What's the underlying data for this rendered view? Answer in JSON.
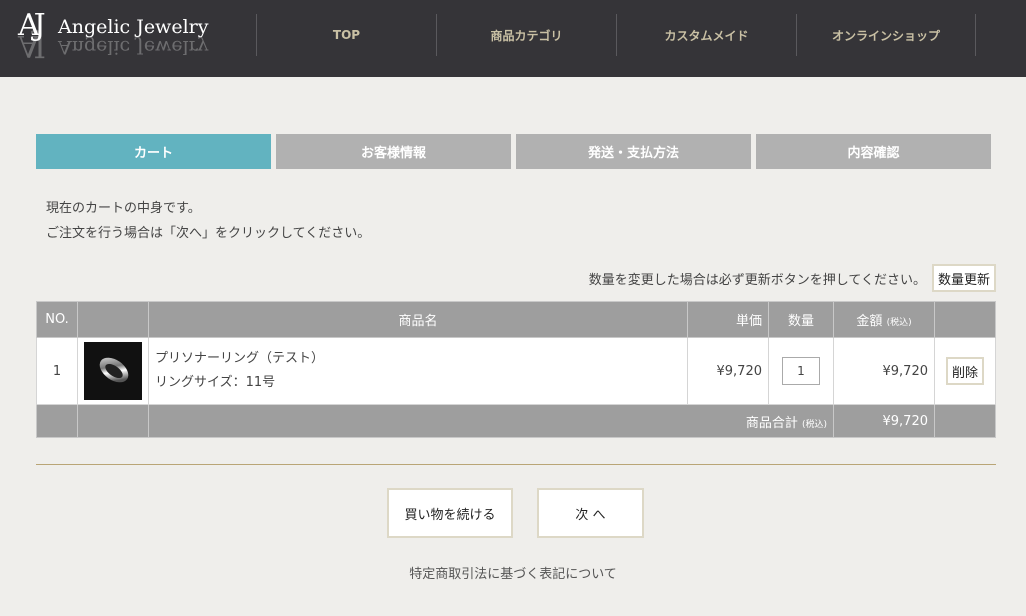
{
  "header": {
    "logo_mark": "AJ",
    "logo_text": "Angelic Jewelry",
    "nav": [
      "TOP",
      "商品カテゴリ",
      "カスタムメイド",
      "オンラインショップ"
    ]
  },
  "steps": [
    "カート",
    "お客様情報",
    "発送・支払方法",
    "内容確認"
  ],
  "intro": {
    "line1": "現在のカートの中身です。",
    "line2": "ご注文を行う場合は「次へ」をクリックしてください。"
  },
  "update": {
    "note": "数量を変更した場合は必ず更新ボタンを押してください。",
    "button": "数量更新"
  },
  "table": {
    "headers": {
      "no": "NO.",
      "name": "商品名",
      "unit_price": "単価",
      "quantity": "数量",
      "amount": "金額",
      "tax_note": "(税込)"
    },
    "rows": [
      {
        "no": "1",
        "name": "プリソナーリング（テスト）",
        "option": "リングサイズ：11号",
        "unit_price": "¥9,720",
        "quantity": "1",
        "amount": "¥9,720",
        "delete": "削除"
      }
    ],
    "total_label": "商品合計",
    "total_tax_note": "(税込)",
    "total_amount": "¥9,720"
  },
  "buttons": {
    "continue": "買い物を続ける",
    "next": "次 へ"
  },
  "footer_link": "特定商取引法に基づく表記について",
  "colors": {
    "header_bg": "#353438",
    "active_step": "#62b3c0",
    "inactive_step": "#b1b1b1",
    "table_header": "#9e9e9e",
    "nav_text": "#c9c0a4"
  }
}
